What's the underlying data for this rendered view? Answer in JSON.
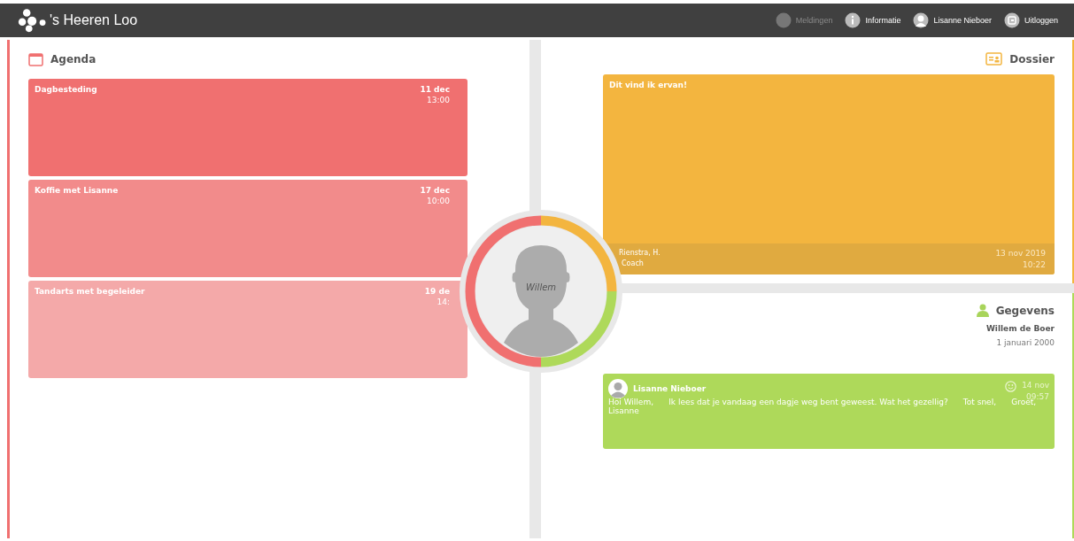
{
  "header": {
    "logo_text": "'s Heeren Loo",
    "nav": [
      {
        "label": "Meldingen",
        "disabled": true
      },
      {
        "label": "Informatie",
        "disabled": false
      },
      {
        "label": "Lisanne Nieboer",
        "disabled": false
      },
      {
        "label": "Uitloggen",
        "disabled": false
      }
    ]
  },
  "agenda": {
    "title": "Agenda",
    "items": [
      {
        "title": "Dagbesteding",
        "date": "11 dec",
        "time": "13:00",
        "color": "#f07070"
      },
      {
        "title": "Koffie met Lisanne",
        "date": "17 dec",
        "time": "10:00",
        "color": "#f28b8b"
      },
      {
        "title": "Tandarts met begeleider",
        "date": "19 de",
        "time": "14:",
        "color": "#f4a9a9"
      }
    ]
  },
  "profile": {
    "name": "Willem"
  },
  "dossier": {
    "title": "Dossier",
    "card": {
      "title": "Dit vind ik ervan!",
      "author": "Rienstra, H.",
      "role": "Coach",
      "date": "13 nov 2019",
      "time": "10:22"
    }
  },
  "gegevens": {
    "title": "Gegevens",
    "name": "Willem de Boer",
    "birthdate": "1 januari 2000"
  },
  "message": {
    "sender": "Lisanne Nieboer",
    "date": "14 nov",
    "time": "09:57",
    "body": "Hoi Willem,      Ik lees dat je vandaag een dagje weg bent geweest. Wat het gezellig?      Tot snel,      Groet, Lisanne"
  }
}
